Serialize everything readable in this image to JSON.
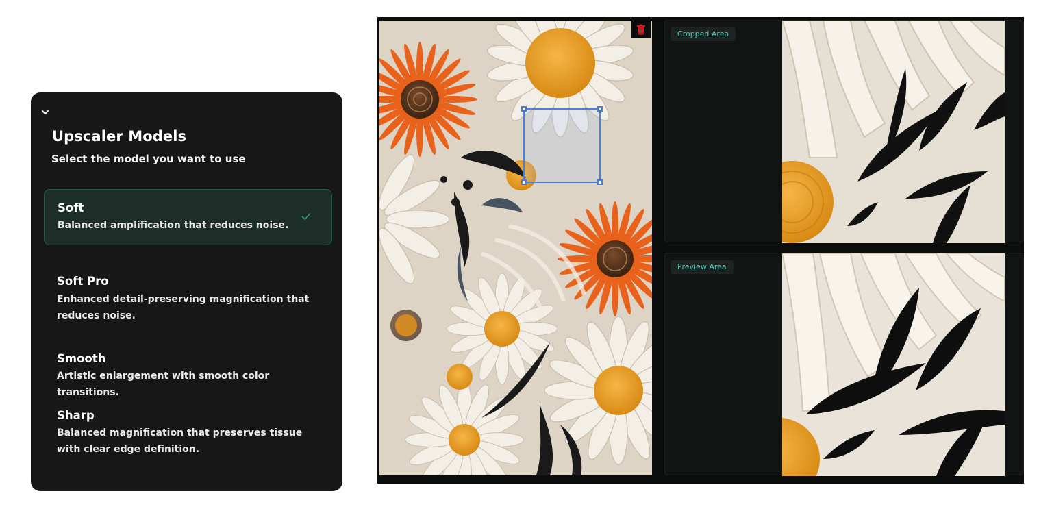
{
  "panel": {
    "title": "Upscaler Models",
    "subtitle": "Select the model you want to use",
    "models": [
      {
        "name": "Soft",
        "desc": "Balanced amplification that reduces noise.",
        "selected": true
      },
      {
        "name": "Soft Pro",
        "desc": "Enhanced detail-preserving magnification that reduces noise.",
        "selected": false
      },
      {
        "name": "Smooth",
        "desc": "Artistic enlargement with smooth color transitions.",
        "selected": false
      },
      {
        "name": "Sharp",
        "desc": "Balanced magnification that preserves tissue with clear edge definition.",
        "selected": false
      }
    ]
  },
  "editor": {
    "cropped_label": "Cropped Area",
    "preview_label": "Preview Area"
  },
  "colors": {
    "panel_bg": "#171718",
    "selected_bg": "#1c2e27",
    "accent_green": "#2fa36b",
    "tag_text": "#52c7b4",
    "crop_blue": "#4a7fe0",
    "trash_red": "#e0161e"
  },
  "icons": [
    "chevron-down-icon",
    "check-icon",
    "trash-icon"
  ]
}
